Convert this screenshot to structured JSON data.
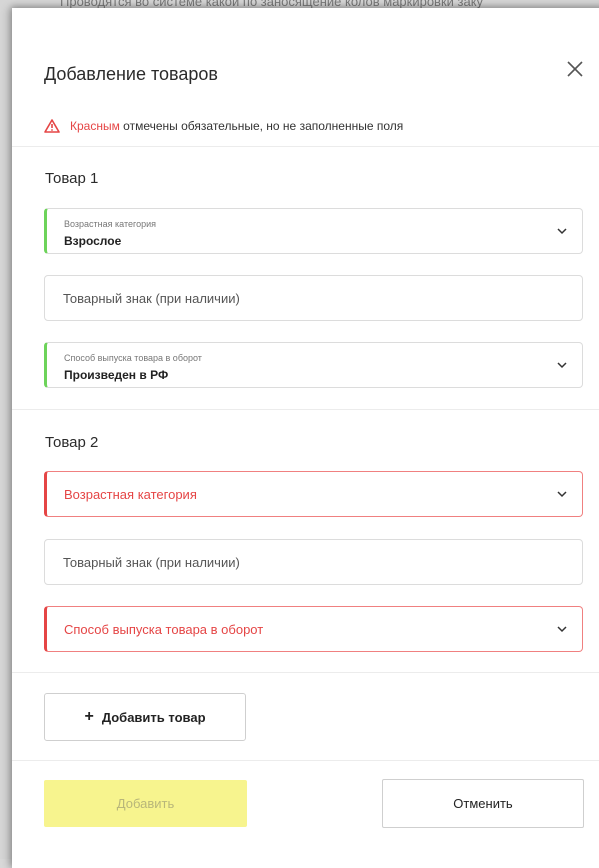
{
  "backdrop": {
    "partial_text": "Проводятся во системе какой по заносящение колов маркировки заку"
  },
  "modal": {
    "title": "Добавление товаров",
    "close_icon": "close-icon",
    "warning": {
      "icon": "warning-triangle-icon",
      "highlight": "Красным",
      "rest": " отмечены обязательные, но не заполненные поля",
      "color": "#e54545"
    },
    "items": [
      {
        "title": "Товар 1",
        "age_category": {
          "label": "Возрастная категория",
          "value": "Взрослое",
          "state": "valid"
        },
        "trademark": {
          "placeholder": "Товарный знак (при наличии)"
        },
        "release_method": {
          "label": "Способ выпуска товара в оборот",
          "value": "Произведен в РФ",
          "state": "valid"
        }
      },
      {
        "title": "Товар 2",
        "age_category": {
          "label": "Возрастная категория",
          "value": "",
          "state": "error"
        },
        "trademark": {
          "placeholder": "Товарный знак (при наличии)"
        },
        "release_method": {
          "label": "Способ выпуска товара в оборот",
          "value": "",
          "state": "error"
        }
      }
    ],
    "add_item_label": "Добавить товар",
    "add_item_icon": "plus-icon",
    "submit_label": "Добавить",
    "cancel_label": "Отменить"
  },
  "colors": {
    "valid_accent": "#6dd35a",
    "error_accent": "#e54545",
    "submit_bg": "#f7f48e"
  }
}
